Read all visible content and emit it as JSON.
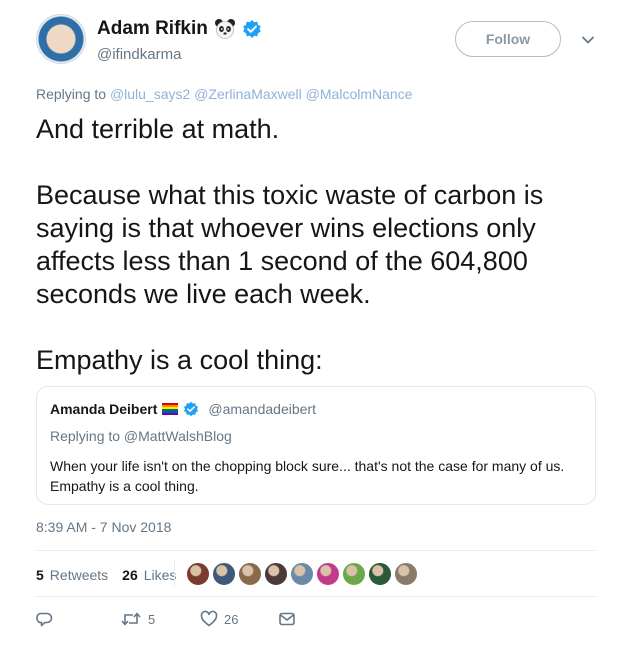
{
  "author": {
    "display_name": "Adam Rifkin",
    "handle": "@ifindkarma",
    "name_emoji": "panda-icon",
    "verified_icon": "verified-badge-icon"
  },
  "follow_label": "Follow",
  "replying": {
    "prefix": "Replying to",
    "mentions": [
      "@lulu_says2",
      "@ZerlinaMaxwell",
      "@MalcolmNance"
    ]
  },
  "tweet_text": "And terrible at math.\n\nBecause what this toxic waste of carbon is saying is that whoever wins elections only affects less than 1 second of the 604,800 seconds we live each week.\n\nEmpathy is a cool thing:",
  "quoted": {
    "display_name": "Amanda Deibert",
    "handle": "@amandadeibert",
    "replying_line": "Replying to @MattWalshBlog",
    "text": "When your life isn't on the chopping block sure... that's not the case for many of us. Empathy is a cool thing."
  },
  "timestamp": "8:39 AM - 7 Nov 2018",
  "stats": {
    "retweets_count": "5",
    "retweets_label": "Retweets",
    "likes_count": "26",
    "likes_label": "Likes"
  },
  "likers_colors": [
    "#7a3b2e",
    "#3d5a7a",
    "#8a6a4a",
    "#4a3a3a",
    "#6a8aa8",
    "#c23a8a",
    "#6aa84a",
    "#2a5a3a",
    "#8a7a6a"
  ],
  "actions": {
    "reply_count": "",
    "retweet_count": "5",
    "like_count": "26"
  },
  "colors": {
    "accent": "#1da1f2",
    "muted": "#657786",
    "border": "#e1e8ed"
  }
}
